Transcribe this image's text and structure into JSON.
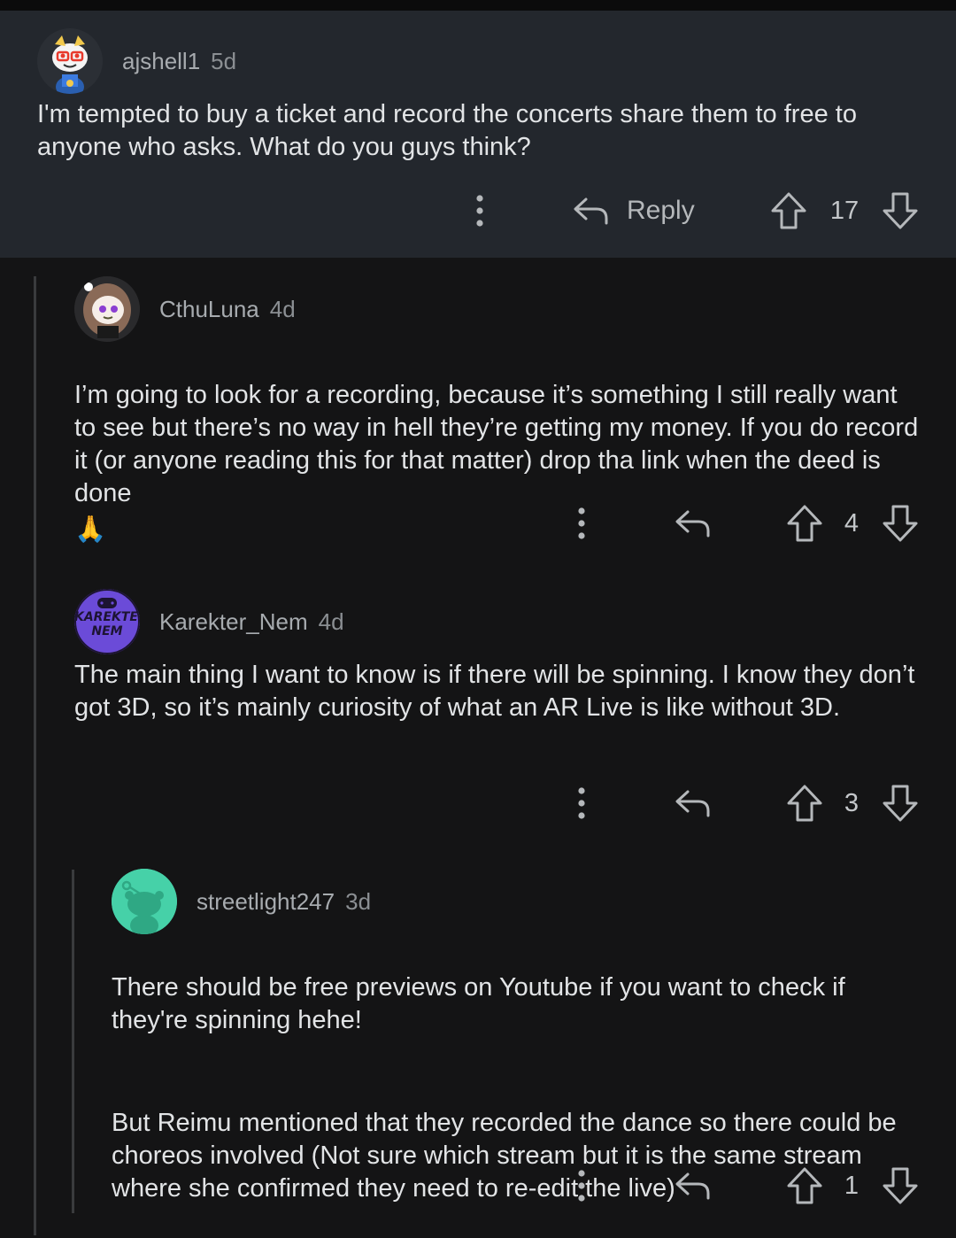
{
  "comments": [
    {
      "user": "ajshell1",
      "age": "5d",
      "body": "I'm tempted to buy a ticket and record the concerts share them to free to anyone who asks. What do you guys think?",
      "reply_label": "Reply",
      "score": "17"
    },
    {
      "user": "CthuLuna",
      "age": "4d",
      "body": "I’m going to look for a recording, because it’s something I still really want to see but there’s no way in hell they’re getting my money. If you do record it (or anyone reading this for that matter) drop tha link when the deed is done",
      "emoji": "🙏",
      "score": "4"
    },
    {
      "user": "Karekter_Nem",
      "age": "4d",
      "avatar_text": "KAREKTER NEM",
      "body": "The main thing I want to know is if there will be spinning. I know they don’t got 3D, so it’s mainly curiosity of what an AR Live is like without 3D.",
      "score": "3"
    },
    {
      "user": "streetlight247",
      "age": "3d",
      "body_paragraphs": [
        "There should be free previews on Youtube if you want to check if they're spinning hehe!",
        "But Reimu mentioned that they recorded the dance so there could be choreos involved (Not sure which stream but it is the same stream where she confirmed they need to re-edit the live)"
      ],
      "score": "1"
    }
  ],
  "colors": {
    "background": "#141415",
    "highlight": "#23272d",
    "thread_line": "#3a3b3d",
    "text": "#e2e4e6",
    "meta": "#a7abaf",
    "karekter_avatar": "#6b4bd8",
    "streetlight_avatar": "#46d1a8"
  },
  "icons": [
    "more-vertical-icon",
    "reply-arrow-icon",
    "upvote-arrow-icon",
    "downvote-arrow-icon",
    "snoo-avatar-icon"
  ]
}
